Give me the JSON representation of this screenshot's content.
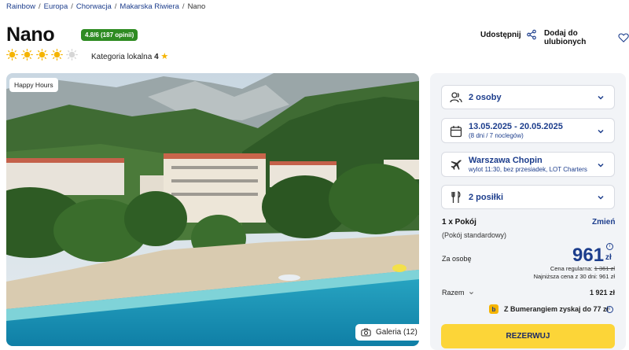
{
  "breadcrumb": [
    "Rainbow",
    "Europa",
    "Chorwacja",
    "Makarska Riwiera",
    "Nano"
  ],
  "hotel": {
    "name": "Nano",
    "rating": "4.8/6 (187 opinii)",
    "suns_filled": 4,
    "suns_total": 5,
    "category_label": "Kategoria lokalna",
    "category_value": "4"
  },
  "actions": {
    "share": "Udostępnij",
    "favorite": "Dodaj do ulubionych"
  },
  "photo": {
    "badge": "Happy Hours",
    "gallery": "Galeria (12)"
  },
  "booking": {
    "persons": "2 osoby",
    "dates": "13.05.2025 - 20.05.2025",
    "dates_sub": "(8 dni / 7 noclegów)",
    "departure": "Warszawa Chopin",
    "departure_sub": "wylot 11:30, bez przesiadek, LOT Charters",
    "meals": "2 posiłki",
    "room": "1 x Pokój",
    "room_change": "Zmień",
    "room_type": "(Pokój standardowy)",
    "per_person_label": "Za osobę",
    "price": "961",
    "currency": "zł",
    "regular_label": "Cena regularna:",
    "regular_price": "1 361 zł",
    "lowest_price": "Najniższa cena z 30 dni: 961 zł",
    "total_label": "Razem",
    "total_value": "1 921 zł",
    "bumerang": "Z Bumerangiem zyskaj do 77 zł",
    "reserve": "REZERWUJ"
  },
  "colors": {
    "brand_blue": "#1c3d8c",
    "accent_yellow": "#fcd538",
    "rating_green": "#2e8b22"
  }
}
